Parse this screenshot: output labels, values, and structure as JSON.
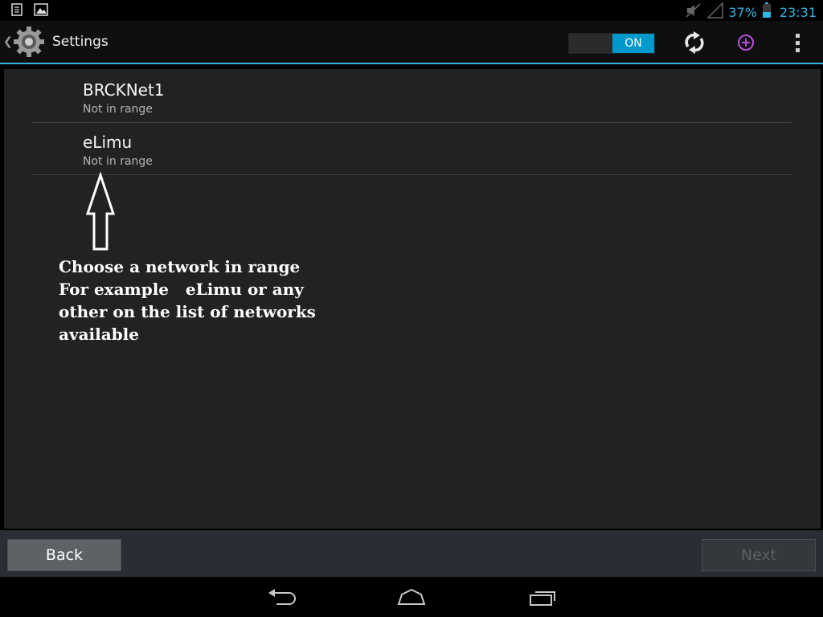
{
  "status_bar": {
    "icons_left": [
      "notification-icon",
      "image-icon"
    ],
    "icons_right": [
      "mute-icon",
      "signal-icon",
      "battery-icon"
    ],
    "battery": "37%",
    "time": "23:31"
  },
  "action_bar": {
    "title": "Settings",
    "wifi_toggle": "ON",
    "icons": [
      "scan-icon",
      "add-network-icon",
      "overflow-menu-icon"
    ]
  },
  "networks": [
    {
      "name": "BRCKNet1",
      "status": "Not in range"
    },
    {
      "name": "eLimu",
      "status": "Not in range"
    }
  ],
  "annotation": {
    "text": "Choose a network in range\nFor example   eLimu or any\nother on the list of networks\navailable"
  },
  "footer": {
    "back_label": "Back",
    "next_label": "Next"
  },
  "colors": {
    "accent": "#33b5e5",
    "toggle_on": "#0099cc",
    "background": "#222222"
  }
}
